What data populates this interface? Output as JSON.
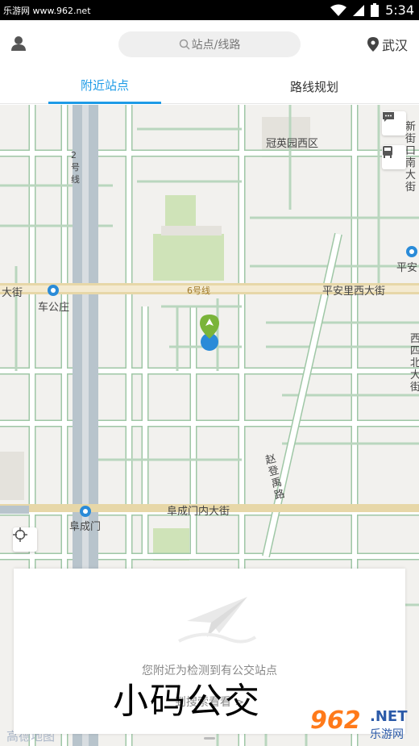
{
  "status_bar": {
    "watermark": "乐游网 www.962.net",
    "time": "5:34"
  },
  "header": {
    "search_placeholder": "站点/线路",
    "city": "武汉"
  },
  "tabs": [
    {
      "label": "附近站点",
      "active": true
    },
    {
      "label": "路线规划",
      "active": false
    }
  ],
  "map": {
    "labels": {
      "area_guanyuan": "冠英园西区",
      "metro2": "2号线",
      "metro6": "6号线",
      "dajie_left": "大街",
      "chegongzhuang": "车公庄",
      "pinganli_xidajie": "平安里西大街",
      "pingan": "平安",
      "fuchengmennei": "阜成门内大街",
      "fuchengmen": "阜成门",
      "zhaodengyu": "赵登禹路",
      "xinjiekou_nandajie": "新街口南大街",
      "xisi_beidajie": "西四北大街"
    }
  },
  "panel": {
    "message": "您附近为检测到有公交站点",
    "link": "到搜索看看 >"
  },
  "branding": {
    "map_provider": "高德地图",
    "caption": "小码公交",
    "logo_number": "962",
    "logo_net": ".NET",
    "logo_cn": "乐游网"
  },
  "colors": {
    "accent": "#1e9be6",
    "road": "#ffffff",
    "road_outline": "#8fbf9a",
    "green_area": "#cfe3b8",
    "metro_line6": "#d8b26a"
  },
  "icons": {
    "user": "person-icon",
    "search": "search-icon",
    "city": "location-pin-icon",
    "messages": "chat-icon",
    "bus": "bus-icon",
    "locate": "crosshair-icon"
  }
}
